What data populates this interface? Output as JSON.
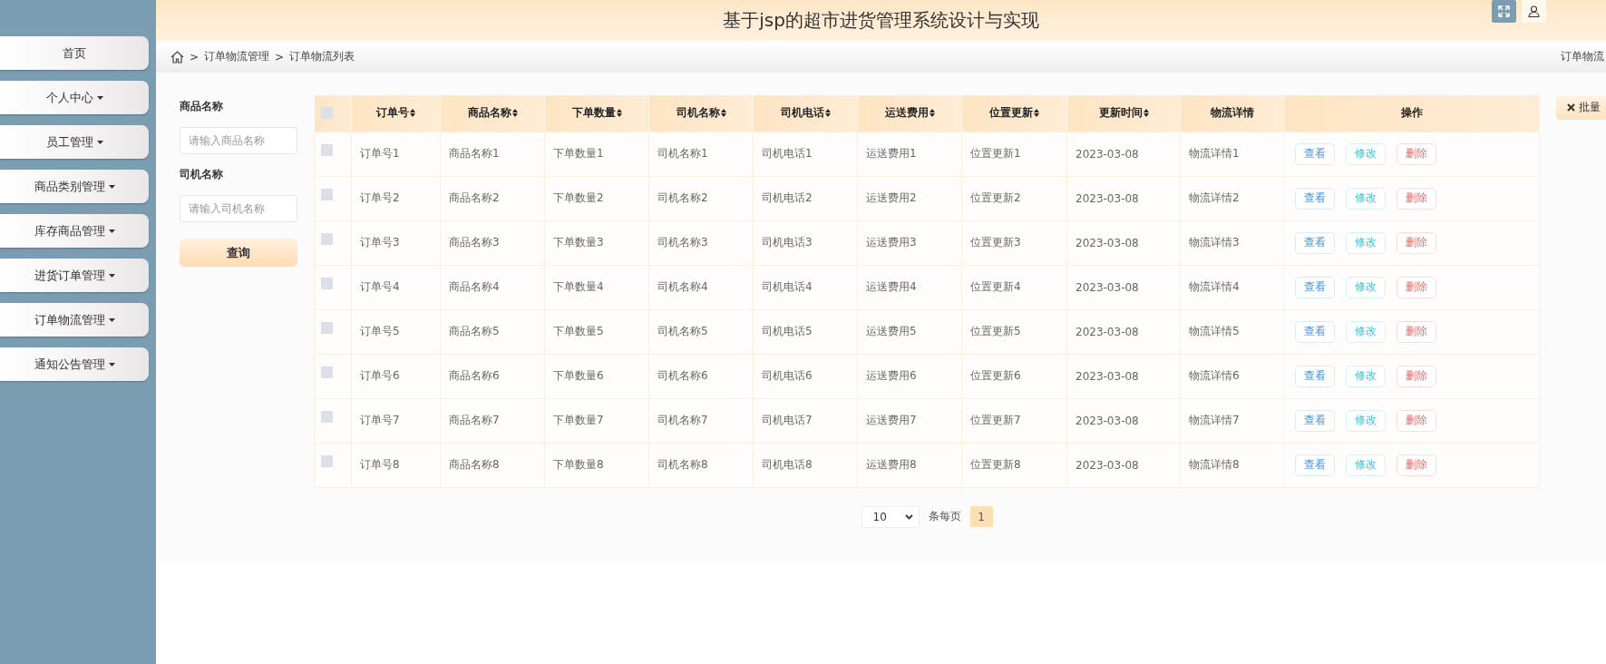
{
  "header": {
    "title": "基于jsp的超市进货管理系统设计与实现"
  },
  "sidebar": {
    "items": [
      {
        "label": "首页",
        "kind": "link"
      },
      {
        "label": "个人中心",
        "kind": "dropdown"
      },
      {
        "label": "员工管理",
        "kind": "dropdown"
      },
      {
        "label": "商品类别管理",
        "kind": "dropdown"
      },
      {
        "label": "库存商品管理",
        "kind": "dropdown"
      },
      {
        "label": "进货订单管理",
        "kind": "dropdown"
      },
      {
        "label": "订单物流管理",
        "kind": "dropdown"
      },
      {
        "label": "通知公告管理",
        "kind": "dropdown"
      }
    ]
  },
  "breadcrumb": {
    "separator": ">",
    "items": [
      "订单物流管理",
      "订单物流列表"
    ],
    "right_text": "订单物流"
  },
  "filters": [
    {
      "label": "商品名称",
      "placeholder": "请输入商品名称"
    },
    {
      "label": "司机名称",
      "placeholder": "请输入司机名称"
    }
  ],
  "search_button": "查询",
  "batch_button": "批量",
  "table": {
    "header_checkbox": {
      "checked": false
    },
    "columns": [
      {
        "label": "订单号",
        "sortable": true
      },
      {
        "label": "商品名称",
        "sortable": true
      },
      {
        "label": "下单数量",
        "sortable": true
      },
      {
        "label": "司机名称",
        "sortable": true
      },
      {
        "label": "司机电话",
        "sortable": true
      },
      {
        "label": "运送费用",
        "sortable": true
      },
      {
        "label": "位置更新",
        "sortable": true
      },
      {
        "label": "更新时间",
        "sortable": true
      },
      {
        "label": "物流详情",
        "sortable": false
      },
      {
        "label": "操作",
        "sortable": false
      }
    ],
    "rows": [
      {
        "checked": false,
        "cells": [
          "订单号1",
          "商品名称1",
          "下单数量1",
          "司机名称1",
          "司机电话1",
          "运送费用1",
          "位置更新1",
          "2023-03-08",
          "物流详情1"
        ],
        "actions": [
          "查看",
          "修改",
          "删除"
        ]
      },
      {
        "checked": false,
        "cells": [
          "订单号2",
          "商品名称2",
          "下单数量2",
          "司机名称2",
          "司机电话2",
          "运送费用2",
          "位置更新2",
          "2023-03-08",
          "物流详情2"
        ],
        "actions": [
          "查看",
          "修改",
          "删除"
        ]
      },
      {
        "checked": false,
        "cells": [
          "订单号3",
          "商品名称3",
          "下单数量3",
          "司机名称3",
          "司机电话3",
          "运送费用3",
          "位置更新3",
          "2023-03-08",
          "物流详情3"
        ],
        "actions": [
          "查看",
          "修改",
          "删除"
        ]
      },
      {
        "checked": false,
        "cells": [
          "订单号4",
          "商品名称4",
          "下单数量4",
          "司机名称4",
          "司机电话4",
          "运送费用4",
          "位置更新4",
          "2023-03-08",
          "物流详情4"
        ],
        "actions": [
          "查看",
          "修改",
          "删除"
        ]
      },
      {
        "checked": false,
        "cells": [
          "订单号5",
          "商品名称5",
          "下单数量5",
          "司机名称5",
          "司机电话5",
          "运送费用5",
          "位置更新5",
          "2023-03-08",
          "物流详情5"
        ],
        "actions": [
          "查看",
          "修改",
          "删除"
        ]
      },
      {
        "checked": false,
        "cells": [
          "订单号6",
          "商品名称6",
          "下单数量6",
          "司机名称6",
          "司机电话6",
          "运送费用6",
          "位置更新6",
          "2023-03-08",
          "物流详情6"
        ],
        "actions": [
          "查看",
          "修改",
          "删除"
        ]
      },
      {
        "checked": false,
        "cells": [
          "订单号7",
          "商品名称7",
          "下单数量7",
          "司机名称7",
          "司机电话7",
          "运送费用7",
          "位置更新7",
          "2023-03-08",
          "物流详情7"
        ],
        "actions": [
          "查看",
          "修改",
          "删除"
        ]
      },
      {
        "checked": false,
        "cells": [
          "订单号8",
          "商品名称8",
          "下单数量8",
          "司机名称8",
          "司机电话8",
          "运送费用8",
          "位置更新8",
          "2023-03-08",
          "物流详情8"
        ],
        "actions": [
          "查看",
          "修改",
          "删除"
        ]
      }
    ]
  },
  "pagination": {
    "page_size": "10",
    "per_page_label": "条每页",
    "pages": [
      {
        "label": "1",
        "selected": true
      }
    ]
  }
}
